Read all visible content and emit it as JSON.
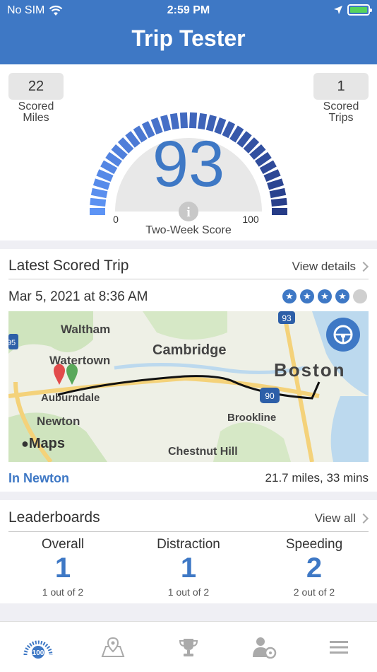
{
  "status": {
    "carrier": "No SIM",
    "time": "2:59 PM"
  },
  "header": {
    "title": "Trip Tester"
  },
  "score": {
    "value": "93",
    "min": "0",
    "max": "100",
    "label": "Two-Week Score",
    "scored_miles": {
      "value": "22",
      "label_line1": "Scored",
      "label_line2": "Miles"
    },
    "scored_trips": {
      "value": "1",
      "label_line1": "Scored",
      "label_line2": "Trips"
    }
  },
  "latest_trip": {
    "title": "Latest Scored Trip",
    "link": "View details",
    "date": "Mar 5, 2021 at 8:36 AM",
    "rating": 4,
    "rating_max": 5,
    "location": "In Newton",
    "summary": "21.7 miles, 33 mins",
    "map": {
      "labels": [
        "Waltham",
        "Cambridge",
        "Watertown",
        "Boston",
        "Auburndale",
        "Newton",
        "Brookline",
        "Chestnut Hill"
      ],
      "attribution": "Maps",
      "route_signs": [
        "93",
        "90",
        "95"
      ]
    }
  },
  "leaderboards": {
    "title": "Leaderboards",
    "link": "View all",
    "items": [
      {
        "name": "Overall",
        "rank": "1",
        "detail": "1 out of 2"
      },
      {
        "name": "Distraction",
        "rank": "1",
        "detail": "1 out of 2"
      },
      {
        "name": "Speeding",
        "rank": "2",
        "detail": "2 out of 2"
      }
    ]
  },
  "tabbar": {
    "items": [
      "score-tab-icon",
      "map-tab-icon",
      "trophy-tab-icon",
      "driver-tab-icon",
      "menu-tab-icon"
    ],
    "active": "score-tab-icon",
    "score_icon_text": "100"
  },
  "colors": {
    "brand": "#3e78c5",
    "star": "#3e78c5",
    "star_empty": "#cfcfcf"
  }
}
